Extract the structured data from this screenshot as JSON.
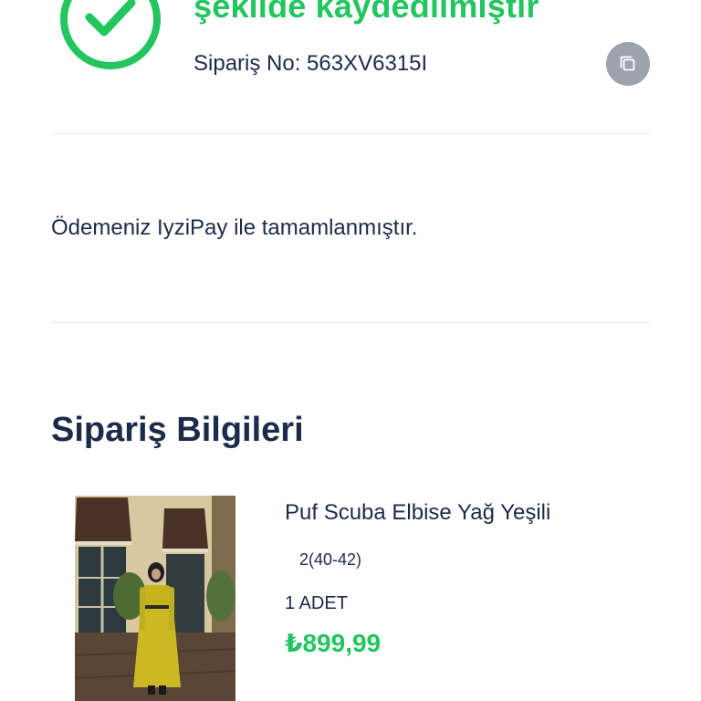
{
  "header": {
    "headline": "şekilde kaydedilmiştir",
    "order_number": "Sipariş No: 563XV6315I"
  },
  "payment": {
    "message": "Ödemeniz IyziPay ile tamamlanmıştır."
  },
  "order_info": {
    "title": "Sipariş Bilgileri",
    "items": [
      {
        "name": "Puf Scuba Elbise Yağ Yeşili",
        "size": "2(40-42)",
        "quantity": "1 ADET",
        "price": "₺899,99"
      }
    ]
  },
  "colors": {
    "accent": "#22c55e",
    "text": "#1c2b4a",
    "copy_button": "#9ca3af",
    "divider": "#e5e7eb"
  },
  "icons": {
    "success": "check-circle-icon",
    "copy": "copy-icon"
  }
}
